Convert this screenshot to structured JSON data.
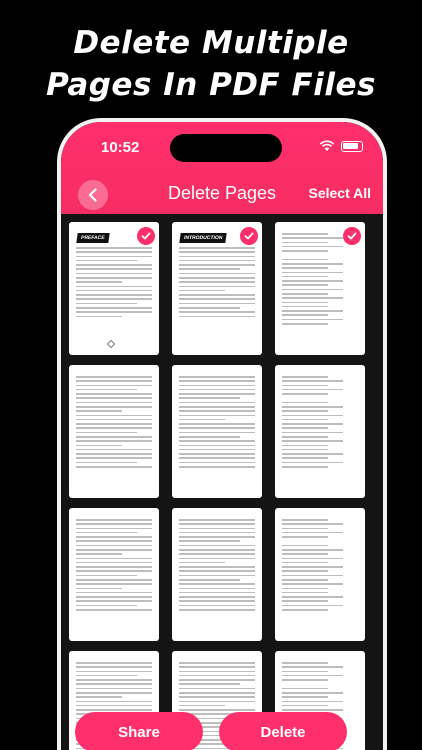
{
  "headline": {
    "line1": "Delete Multiple",
    "line2": "Pages In PDF Files"
  },
  "status_bar": {
    "time": "10:52",
    "icons": [
      "wifi-icon",
      "battery-icon"
    ]
  },
  "header": {
    "title": "Delete Pages",
    "select_all_label": "Select All",
    "back_icon": "chevron-left-icon"
  },
  "pages": [
    {
      "heading": "PREFACE",
      "selected": true
    },
    {
      "heading": "INTRODUCTION",
      "selected": true
    },
    {
      "heading": "",
      "selected": true
    },
    {
      "heading": "",
      "selected": false
    },
    {
      "heading": "",
      "selected": false
    },
    {
      "heading": "",
      "selected": false
    },
    {
      "heading": "",
      "selected": false
    },
    {
      "heading": "",
      "selected": false
    },
    {
      "heading": "",
      "selected": false
    },
    {
      "heading": "",
      "selected": false
    },
    {
      "heading": "",
      "selected": false
    },
    {
      "heading": "",
      "selected": false
    }
  ],
  "actions": {
    "share_label": "Share",
    "delete_label": "Delete"
  },
  "colors": {
    "accent": "#ff2f6c",
    "background": "#000000"
  }
}
